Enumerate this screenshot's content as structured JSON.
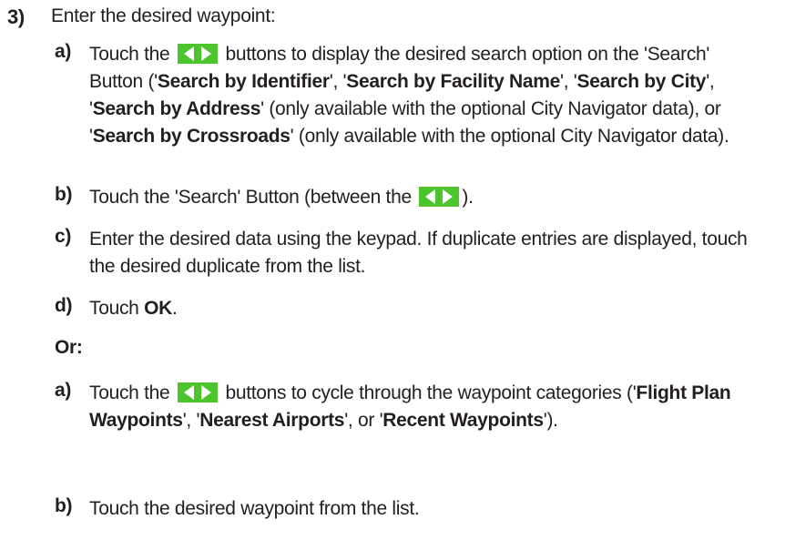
{
  "step": {
    "number": "3)",
    "text": "Enter the desired waypoint:"
  },
  "icons": {
    "arrow_buttons": "left-right-arrow-buttons-icon",
    "color": "#4cc52d"
  },
  "substeps_a": [
    {
      "letter": "a)",
      "t1": "Touch the ",
      "t2": " buttons to display the desired search option on the 'Search' Button ('",
      "b1": "Search by Identifier",
      "t3": "', '",
      "b2": "Search by Facility Name",
      "t4": "', '",
      "b3": "Search by City",
      "t5": "', '",
      "b4": "Search by Address",
      "t6": "' (only available with the optional City Navigator data), or '",
      "b5": "Search by Crossroads",
      "t7": "' (only available with the optional City Navigator data)."
    },
    {
      "letter": "b)",
      "t1": "Touch the 'Search' Button (between the ",
      "t2": ")."
    },
    {
      "letter": "c)",
      "t1": "Enter the desired data using the keypad.  If duplicate entries are displayed, touch the desired duplicate from the list."
    },
    {
      "letter": "d)",
      "t1": "Touch ",
      "b1": "OK",
      "t2": "."
    }
  ],
  "or_label": "Or:",
  "substeps_b": [
    {
      "letter": "a)",
      "t1": "Touch the ",
      "t2": " buttons to cycle through the waypoint categories ('",
      "b1": "Flight Plan Waypoints",
      "t3": "', '",
      "b2": "Nearest Airports",
      "t4": "', or '",
      "b3": "Recent Waypoints",
      "t5": "')."
    },
    {
      "letter": "b)",
      "t1": "Touch the desired waypoint from the list."
    }
  ]
}
